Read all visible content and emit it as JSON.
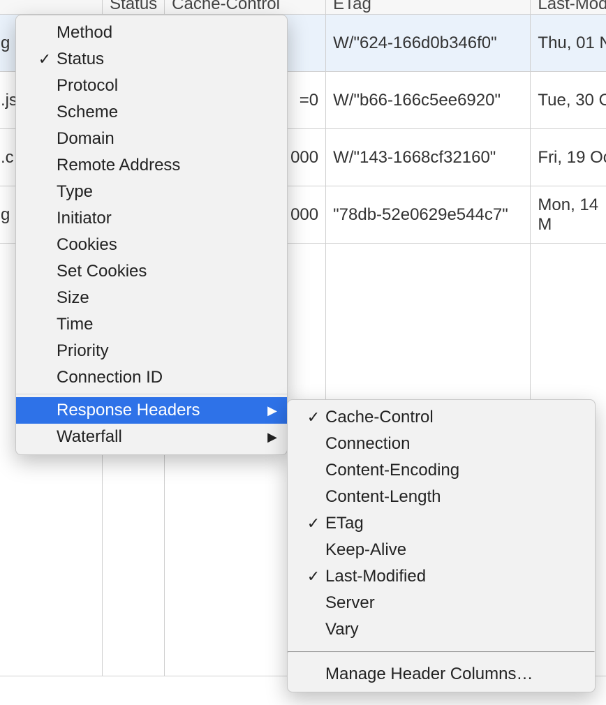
{
  "columns": {
    "name": "",
    "status": "Status",
    "cache": "Cache-Control",
    "etag": "ETag",
    "last": "Last-Mod"
  },
  "rows": [
    {
      "name": "g",
      "status": "",
      "cache": "",
      "etag": "W/\"624-166d0b346f0\"",
      "last": "Thu, 01 N",
      "selected": true
    },
    {
      "name": ".js",
      "status": "",
      "cache": "=0",
      "etag": "W/\"b66-166c5ee6920\"",
      "last": "Tue, 30 O",
      "selected": false
    },
    {
      "name": ".c",
      "status": "",
      "cache": "000",
      "etag": "W/\"143-1668cf32160\"",
      "last": "Fri, 19 Oc",
      "selected": false
    },
    {
      "name": "g\nrg",
      "status": "",
      "cache": "000",
      "etag": "\"78db-52e0629e544c7\"",
      "last": "Mon, 14 M",
      "selected": false
    }
  ],
  "menu": {
    "items": [
      {
        "label": "Method",
        "checked": false,
        "submenu": false
      },
      {
        "label": "Status",
        "checked": true,
        "submenu": false
      },
      {
        "label": "Protocol",
        "checked": false,
        "submenu": false
      },
      {
        "label": "Scheme",
        "checked": false,
        "submenu": false
      },
      {
        "label": "Domain",
        "checked": false,
        "submenu": false
      },
      {
        "label": "Remote Address",
        "checked": false,
        "submenu": false
      },
      {
        "label": "Type",
        "checked": false,
        "submenu": false
      },
      {
        "label": "Initiator",
        "checked": false,
        "submenu": false
      },
      {
        "label": "Cookies",
        "checked": false,
        "submenu": false
      },
      {
        "label": "Set Cookies",
        "checked": false,
        "submenu": false
      },
      {
        "label": "Size",
        "checked": false,
        "submenu": false
      },
      {
        "label": "Time",
        "checked": false,
        "submenu": false
      },
      {
        "label": "Priority",
        "checked": false,
        "submenu": false
      },
      {
        "label": "Connection ID",
        "checked": false,
        "submenu": false
      }
    ],
    "sections": [
      {
        "label": "Response Headers",
        "checked": false,
        "submenu": true,
        "highlight": true
      },
      {
        "label": "Waterfall",
        "checked": false,
        "submenu": true,
        "highlight": false
      }
    ]
  },
  "submenu": {
    "items": [
      {
        "label": "Cache-Control",
        "checked": true
      },
      {
        "label": "Connection",
        "checked": false
      },
      {
        "label": "Content-Encoding",
        "checked": false
      },
      {
        "label": "Content-Length",
        "checked": false
      },
      {
        "label": "ETag",
        "checked": true
      },
      {
        "label": "Keep-Alive",
        "checked": false
      },
      {
        "label": "Last-Modified",
        "checked": true
      },
      {
        "label": "Server",
        "checked": false
      },
      {
        "label": "Vary",
        "checked": false
      }
    ],
    "manage": "Manage Header Columns…"
  },
  "checkmark": "✓",
  "arrow": "▶"
}
